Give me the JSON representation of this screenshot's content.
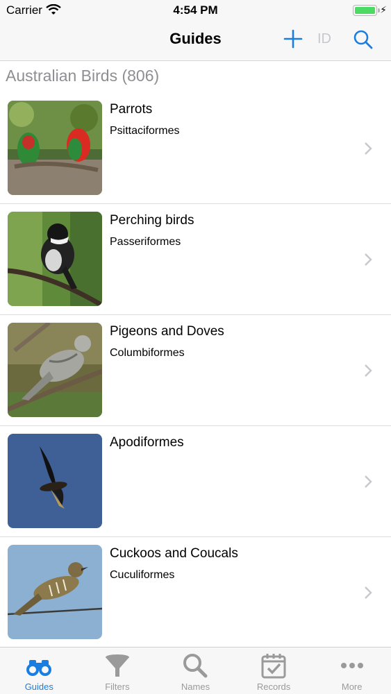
{
  "status": {
    "carrier": "Carrier",
    "time": "4:54 PM"
  },
  "nav": {
    "title": "Guides",
    "id_label": "ID"
  },
  "section": {
    "title": "Australian Birds (806)"
  },
  "items": [
    {
      "title": "Parrots",
      "subtitle": "Psittaciformes"
    },
    {
      "title": "Perching birds",
      "subtitle": "Passeriformes"
    },
    {
      "title": "Pigeons and Doves",
      "subtitle": "Columbiformes"
    },
    {
      "title": "Apodiformes",
      "subtitle": ""
    },
    {
      "title": "Cuckoos and Coucals",
      "subtitle": "Cuculiformes"
    }
  ],
  "tabs": [
    {
      "label": "Guides",
      "icon": "binoculars-icon",
      "active": true
    },
    {
      "label": "Filters",
      "icon": "funnel-icon",
      "active": false
    },
    {
      "label": "Names",
      "icon": "magnifier-icon",
      "active": false
    },
    {
      "label": "Records",
      "icon": "calendar-check-icon",
      "active": false
    },
    {
      "label": "More",
      "icon": "more-dots-icon",
      "active": false
    }
  ],
  "colors": {
    "accent": "#1a7ee0",
    "inactive": "#9a9a9a",
    "battery": "#4cd964"
  }
}
